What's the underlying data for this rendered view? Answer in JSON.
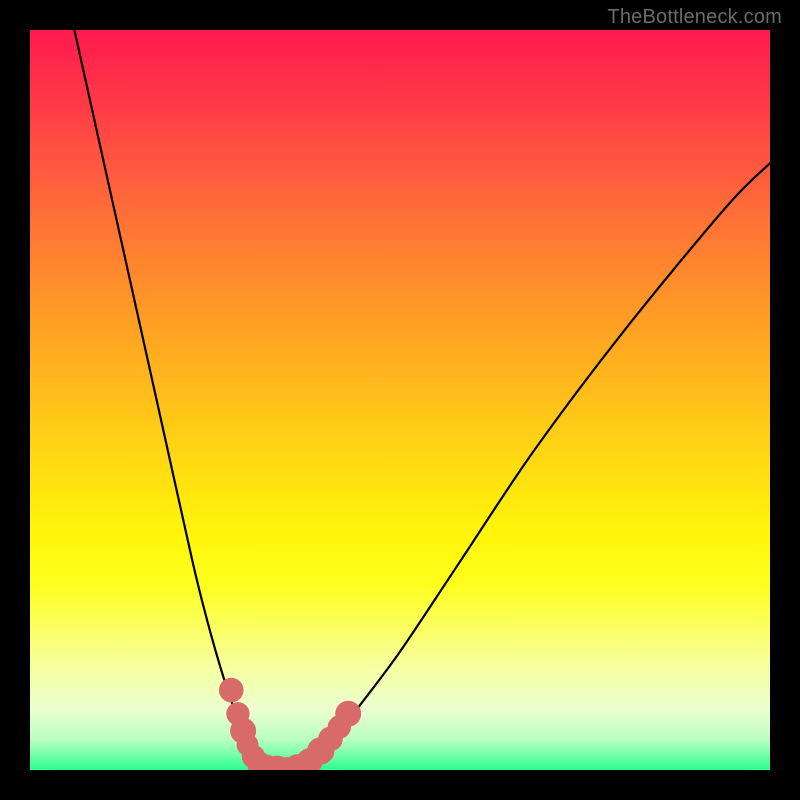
{
  "watermark": "TheBottleneck.com",
  "chart_data": {
    "type": "line",
    "title": "",
    "xlabel": "",
    "ylabel": "",
    "xlim": [
      0,
      100
    ],
    "ylim": [
      0,
      100
    ],
    "grid": false,
    "series": [
      {
        "name": "left-curve",
        "x": [
          6,
          10,
          14,
          18,
          22,
          24,
          26,
          28,
          29,
          30,
          31,
          32
        ],
        "y": [
          100,
          82,
          64,
          46,
          28,
          20,
          13,
          7,
          4,
          2,
          1,
          0
        ]
      },
      {
        "name": "right-curve",
        "x": [
          35,
          37,
          40,
          44,
          50,
          58,
          68,
          80,
          94,
          100
        ],
        "y": [
          0,
          1,
          3,
          8,
          16,
          28,
          43,
          59,
          76,
          82
        ]
      }
    ],
    "markers": [
      {
        "x": 27.2,
        "y": 10.8,
        "r": 1.1
      },
      {
        "x": 28.1,
        "y": 7.6,
        "r": 1.0
      },
      {
        "x": 28.8,
        "y": 5.3,
        "r": 1.2
      },
      {
        "x": 29.4,
        "y": 3.4,
        "r": 0.9
      },
      {
        "x": 30.2,
        "y": 1.8,
        "r": 1.0
      },
      {
        "x": 31.0,
        "y": 0.8,
        "r": 1.1
      },
      {
        "x": 32.0,
        "y": 0.3,
        "r": 1.2
      },
      {
        "x": 33.4,
        "y": 0.1,
        "r": 1.3
      },
      {
        "x": 34.8,
        "y": 0.0,
        "r": 1.2
      },
      {
        "x": 36.2,
        "y": 0.3,
        "r": 1.3
      },
      {
        "x": 37.8,
        "y": 1.2,
        "r": 1.2
      },
      {
        "x": 39.3,
        "y": 2.6,
        "r": 1.3
      },
      {
        "x": 40.6,
        "y": 4.2,
        "r": 1.1
      },
      {
        "x": 41.8,
        "y": 5.8,
        "r": 1.0
      },
      {
        "x": 43.0,
        "y": 7.6,
        "r": 1.2
      }
    ],
    "background_gradient": {
      "top": "#ff1a4d",
      "mid": "#fff60a",
      "bottom": "#2cff8e"
    }
  }
}
